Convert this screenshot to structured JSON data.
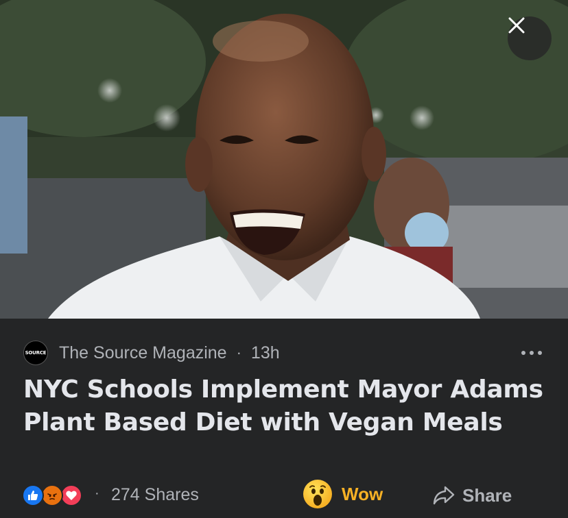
{
  "photo": {
    "alt_subject": "smiling man in white shirt",
    "close_icon": "close-icon"
  },
  "post": {
    "source": {
      "avatar_text": "SOURCE",
      "name": "The Source Magazine",
      "separator": "·",
      "time": "13h"
    },
    "more_icon": "more-horizontal-icon",
    "headline": "NYC Schools Implement Mayor Adams Plant Based Diet with Vegan Meals",
    "footer": {
      "reactions": [
        "like-icon",
        "angry-icon",
        "love-icon"
      ],
      "separator": "·",
      "shares": "274 Shares",
      "wow_label": "Wow",
      "share_label": "Share"
    }
  },
  "colors": {
    "background": "#242526",
    "text_primary": "#e4e6eb",
    "text_secondary": "#b0b3b8",
    "wow_accent": "#f7b125",
    "like_blue": "#1877f2"
  }
}
